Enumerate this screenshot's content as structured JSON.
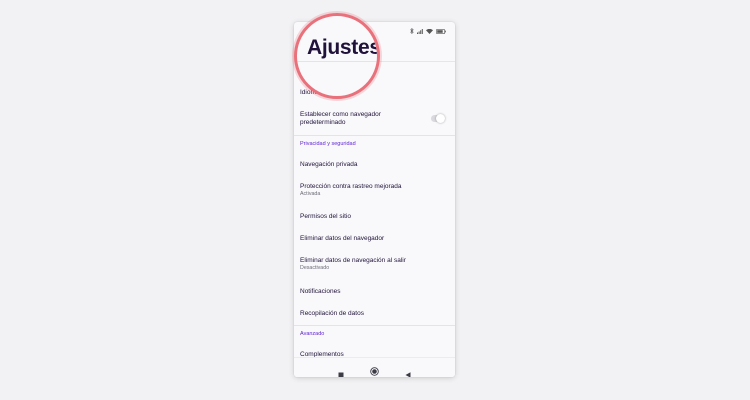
{
  "appbar": {
    "title": "Ajustes"
  },
  "settings": {
    "idioma": "Idioma",
    "default_browser": "Establecer como navegador predeterminado",
    "privacy_header": "Privacidad y seguridad",
    "private_browsing": "Navegación privada",
    "tracking_protection": {
      "label": "Protección contra rastreo mejorada",
      "status": "Activada"
    },
    "site_permissions": "Permisos del sitio",
    "delete_browsing_data": "Eliminar datos del navegador",
    "delete_on_quit": {
      "label": "Eliminar datos de navegación al salir",
      "status": "Desactivado"
    },
    "notifications": "Notificaciones",
    "data_collection": "Recopilación de datos",
    "advanced_header": "Avanzado",
    "addons": "Complementos"
  },
  "default_browser_toggle": {
    "on": false
  },
  "colors": {
    "accent": "#5b1fd1",
    "highlight_ring": "#e9717b",
    "text": "#20123a"
  },
  "icons": {
    "status": [
      "bluetooth-icon",
      "signal-icon",
      "wifi-icon",
      "battery-icon"
    ],
    "nav": [
      "recents-square-icon",
      "home-circle-icon",
      "back-triangle-icon"
    ]
  }
}
